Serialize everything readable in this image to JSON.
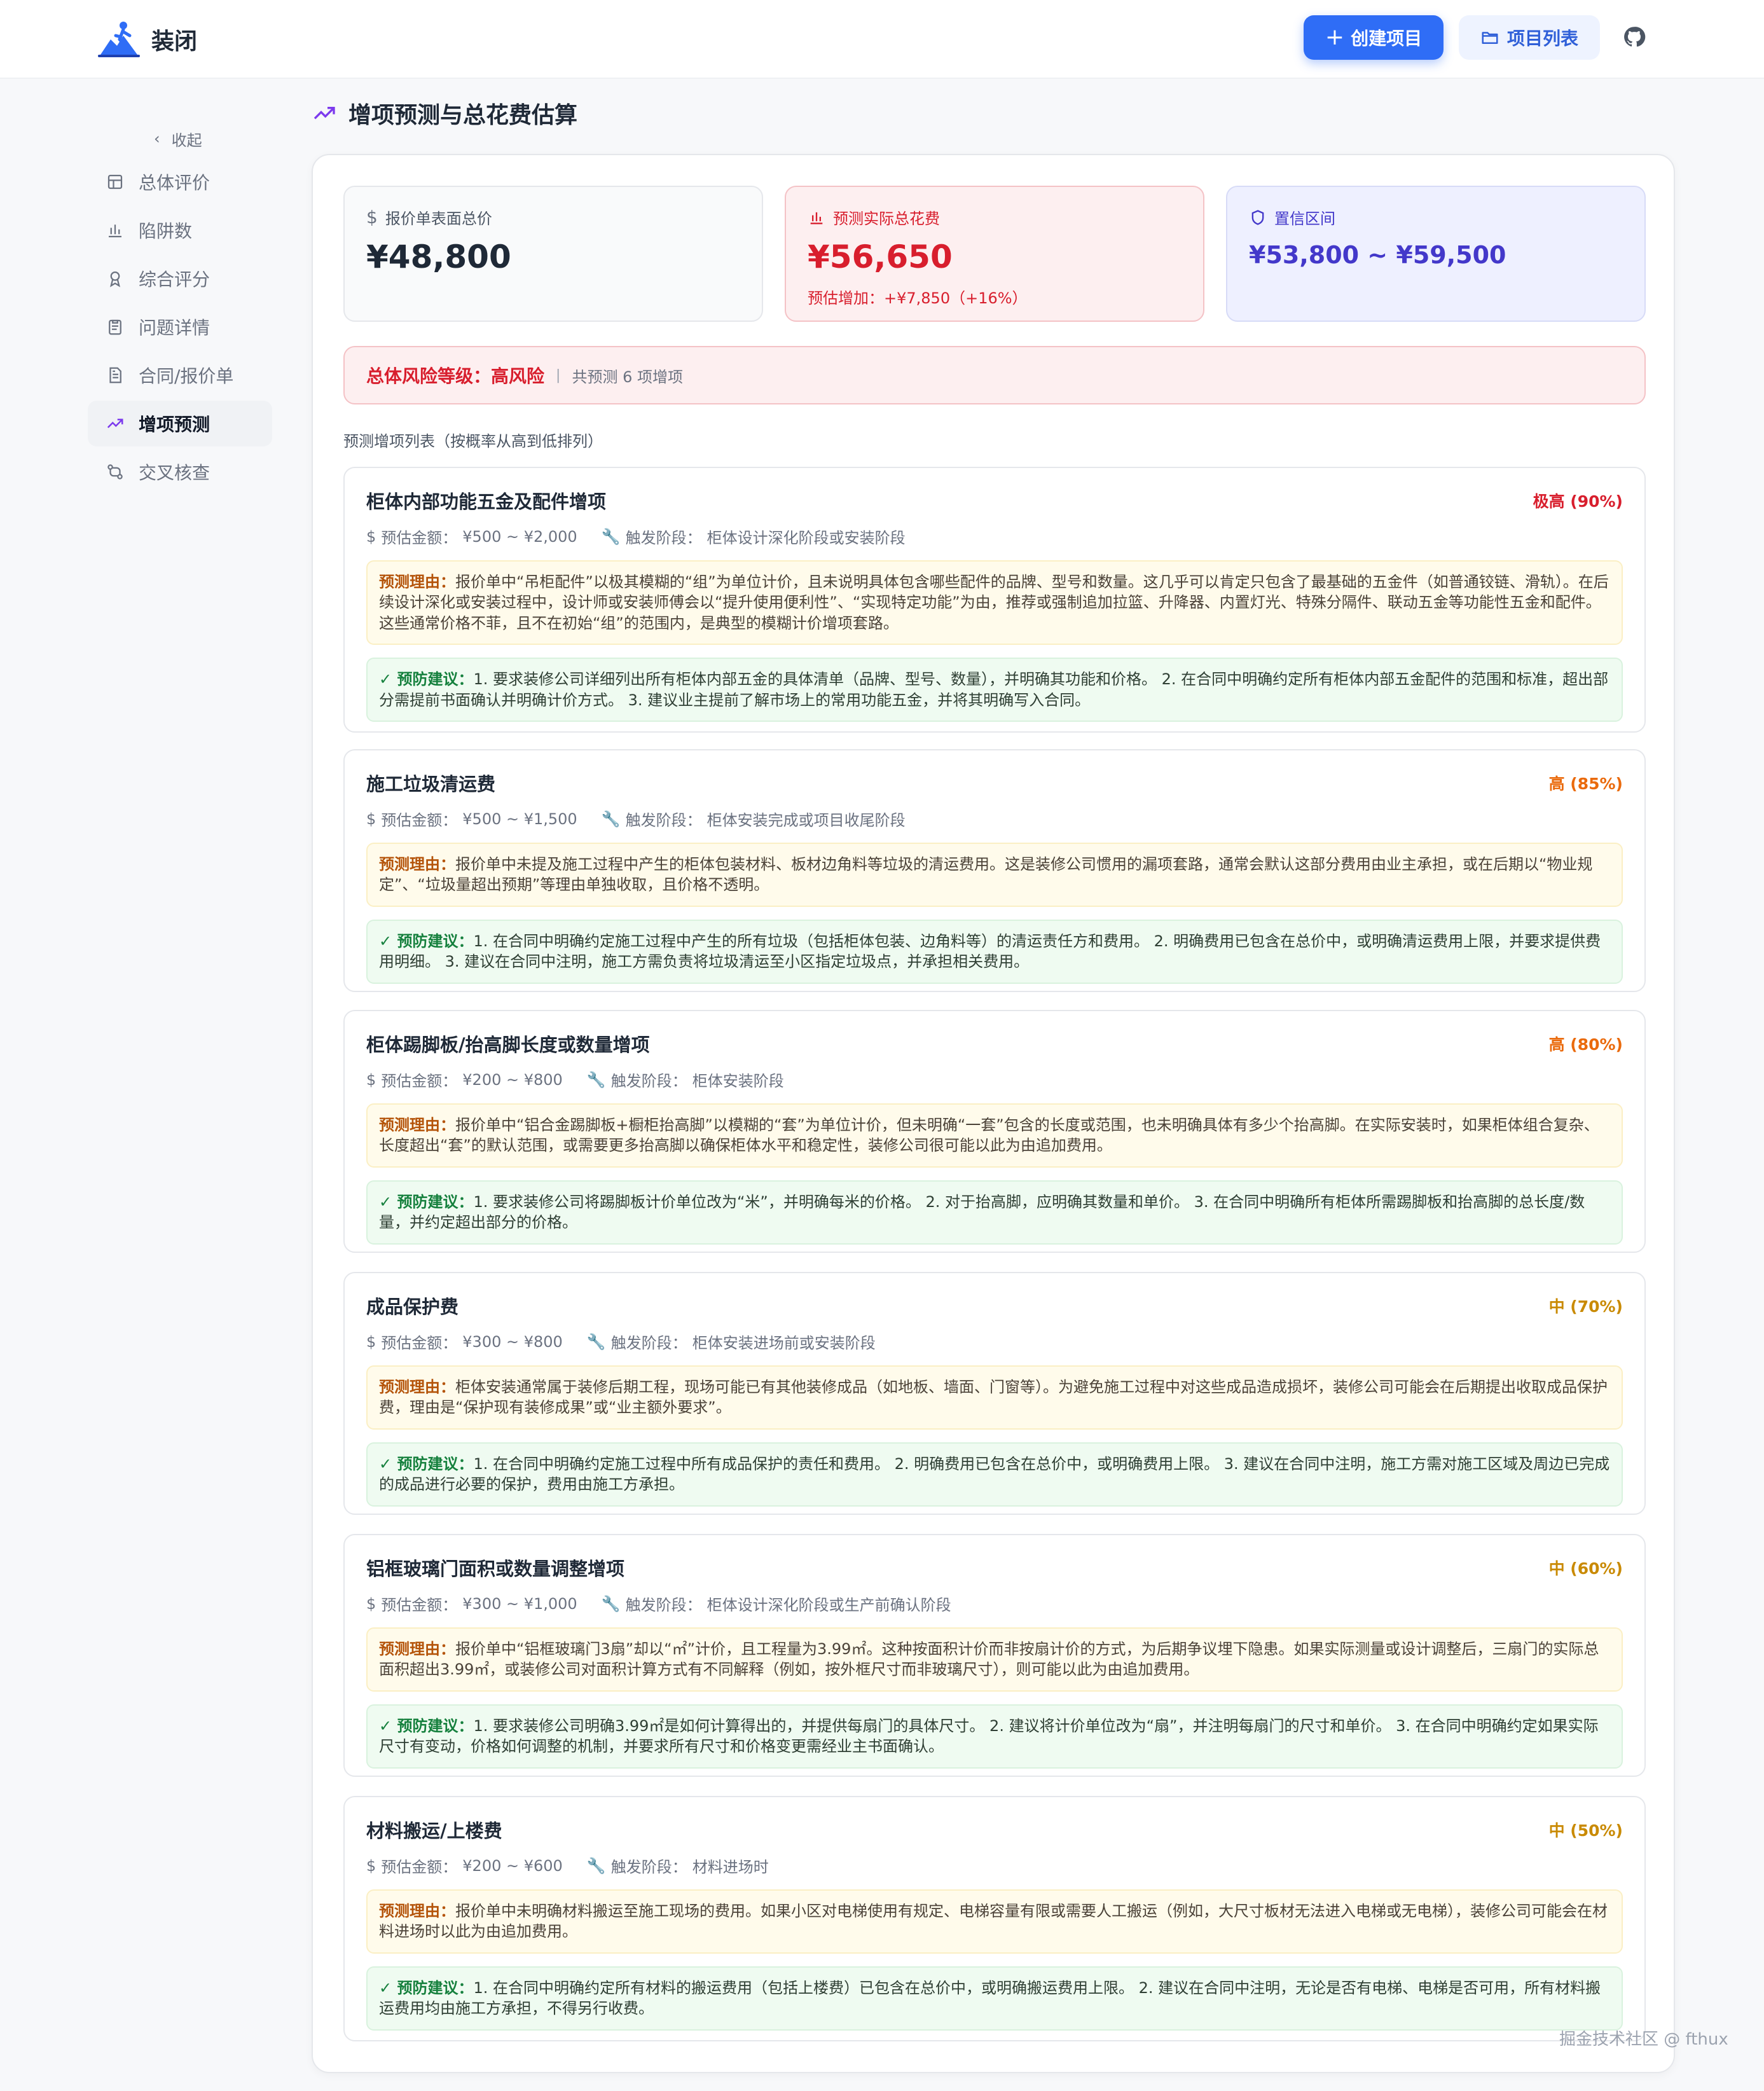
{
  "header": {
    "brand_name": "装闭",
    "create_label": "创建项目",
    "list_label": "项目列表",
    "github_icon": "github-icon"
  },
  "sidebar": {
    "collapse_label": "收起",
    "items": [
      {
        "label": "总体评价",
        "icon": "layout-icon"
      },
      {
        "label": "陷阱数",
        "icon": "bar-chart-icon"
      },
      {
        "label": "综合评分",
        "icon": "award-icon"
      },
      {
        "label": "问题详情",
        "icon": "clipboard-icon"
      },
      {
        "label": "合同/报价单",
        "icon": "file-text-icon"
      },
      {
        "label": "增项预测",
        "icon": "trending-up-icon",
        "active": true
      },
      {
        "label": "交叉核查",
        "icon": "git-compare-icon"
      }
    ]
  },
  "main": {
    "title": "增项预测与总花费估算",
    "stats": {
      "quote_label": "报价单表面总价",
      "quote_value": "¥48,800",
      "predicted_label": "预测实际总花费",
      "predicted_value": "¥56,650",
      "predicted_sub": "预估增加：+¥7,850（+16%）",
      "ci_label": "置信区间",
      "ci_value": "¥53,800 ~ ¥59,500"
    },
    "risk": {
      "label": "总体风险等级：",
      "value": "高风险",
      "separator": "|",
      "count": "共预测 6 项增项"
    },
    "list_caption": "预测增项列表（按概率从高到低排列）",
    "amount_label": "预估金额：",
    "stage_label": "触发阶段：",
    "reason_label": "预测理由：",
    "advice_label": "✓ 预防建议：",
    "items": [
      {
        "name": "柜体内部功能五金及配件增项",
        "prob": "极高 (90%)",
        "amount": "¥500 ~ ¥2,000",
        "stage": "柜体设计深化阶段或安装阶段",
        "reason": "报价单中“吊柜配件”以极其模糊的“组”为单位计价，且未说明具体包含哪些配件的品牌、型号和数量。这几乎可以肯定只包含了最基础的五金件（如普通铰链、滑轨）。在后续设计深化或安装过程中，设计师或安装师傅会以“提升使用便利性”、“实现特定功能”为由，推荐或强制追加拉篮、升降器、内置灯光、特殊分隔件、联动五金等功能性五金和配件。这些通常价格不菲，且不在初始“组”的范围内，是典型的模糊计价增项套路。",
        "advice": "1. 要求装修公司详细列出所有柜体内部五金的具体清单（品牌、型号、数量），并明确其功能和价格。 2. 在合同中明确约定所有柜体内部五金配件的范围和标准，超出部分需提前书面确认并明确计价方式。 3. 建议业主提前了解市场上的常用功能五金，并将其明确写入合同。"
      },
      {
        "name": "施工垃圾清运费",
        "prob": "高 (85%)",
        "amount": "¥500 ~ ¥1,500",
        "stage": "柜体安装完成或项目收尾阶段",
        "reason": "报价单中未提及施工过程中产生的柜体包装材料、板材边角料等垃圾的清运费用。这是装修公司惯用的漏项套路，通常会默认这部分费用由业主承担，或在后期以“物业规定”、“垃圾量超出预期”等理由单独收取，且价格不透明。",
        "advice": "1. 在合同中明确约定施工过程中产生的所有垃圾（包括柜体包装、边角料等）的清运责任方和费用。 2. 明确费用已包含在总价中，或明确清运费用上限，并要求提供费用明细。 3. 建议在合同中注明，施工方需负责将垃圾清运至小区指定垃圾点，并承担相关费用。"
      },
      {
        "name": "柜体踢脚板/抬高脚长度或数量增项",
        "prob": "高 (80%)",
        "amount": "¥200 ~ ¥800",
        "stage": "柜体安装阶段",
        "reason": "报价单中“铝合金踢脚板+橱柜抬高脚”以模糊的“套”为单位计价，但未明确“一套”包含的长度或范围，也未明确具体有多少个抬高脚。在实际安装时，如果柜体组合复杂、长度超出“套”的默认范围，或需要更多抬高脚以确保柜体水平和稳定性，装修公司很可能以此为由追加费用。",
        "advice": "1. 要求装修公司将踢脚板计价单位改为“米”，并明确每米的价格。 2. 对于抬高脚，应明确其数量和单价。 3. 在合同中明确所有柜体所需踢脚板和抬高脚的总长度/数量，并约定超出部分的价格。"
      },
      {
        "name": "成品保护费",
        "prob": "中 (70%)",
        "amount": "¥300 ~ ¥800",
        "stage": "柜体安装进场前或安装阶段",
        "reason": "柜体安装通常属于装修后期工程，现场可能已有其他装修成品（如地板、墙面、门窗等）。为避免施工过程中对这些成品造成损坏，装修公司可能会在后期提出收取成品保护费，理由是“保护现有装修成果”或“业主额外要求”。",
        "advice": "1. 在合同中明确约定施工过程中所有成品保护的责任和费用。 2. 明确费用已包含在总价中，或明确费用上限。 3. 建议在合同中注明，施工方需对施工区域及周边已完成的成品进行必要的保护，费用由施工方承担。"
      },
      {
        "name": "铝框玻璃门面积或数量调整增项",
        "prob": "中 (60%)",
        "amount": "¥300 ~ ¥1,000",
        "stage": "柜体设计深化阶段或生产前确认阶段",
        "reason": "报价单中“铝框玻璃门3扇”却以“㎡”计价，且工程量为3.99㎡。这种按面积计价而非按扇计价的方式，为后期争议埋下隐患。如果实际测量或设计调整后，三扇门的实际总面积超出3.99㎡，或装修公司对面积计算方式有不同解释（例如，按外框尺寸而非玻璃尺寸），则可能以此为由追加费用。",
        "advice": "1. 要求装修公司明确3.99㎡是如何计算得出的，并提供每扇门的具体尺寸。 2. 建议将计价单位改为“扇”，并注明每扇门的尺寸和单价。 3. 在合同中明确约定如果实际尺寸有变动，价格如何调整的机制，并要求所有尺寸和价格变更需经业主书面确认。"
      },
      {
        "name": "材料搬运/上楼费",
        "prob": "中 (50%)",
        "amount": "¥200 ~ ¥600",
        "stage": "材料进场时",
        "reason": "报价单中未明确材料搬运至施工现场的费用。如果小区对电梯使用有规定、电梯容量有限或需要人工搬运（例如，大尺寸板材无法进入电梯或无电梯），装修公司可能会在材料进场时以此为由追加费用。",
        "advice": "1. 在合同中明确约定所有材料的搬运费用（包括上楼费）已包含在总价中，或明确搬运费用上限。 2. 建议在合同中注明，无论是否有电梯、电梯是否可用，所有材料搬运费用均由施工方承担，不得另行收费。"
      }
    ]
  },
  "watermark": "掘金技术社区 @ fthux"
}
